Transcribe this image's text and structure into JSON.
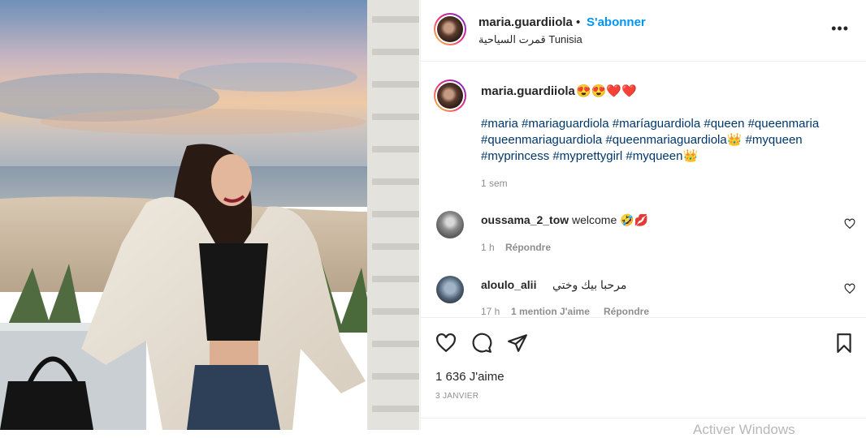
{
  "header": {
    "username": "maria.guardiiola",
    "separator": "•",
    "follow_label": "S'abonner",
    "location": "قمرت السياحية Tunisia",
    "more_label": "•••"
  },
  "caption": {
    "username": "maria.guardiiola",
    "emojis": "😍😍❤️❤️",
    "hashtags_line1": [
      "#maria",
      "#mariaguardiola",
      "#maríaguardiola",
      "#queen",
      "#queenmaria"
    ],
    "hashtags_line2": [
      "#queenmariaguardiola",
      "#queenmariaguardiola👑",
      "#myqueen"
    ],
    "hashtags_line3": [
      "#myprincess",
      "#myprettygirl",
      "#myqueen👑"
    ],
    "time": "1 sem"
  },
  "comments": [
    {
      "username": "oussama_2_tow",
      "text": "welcome 🤣💋",
      "time": "1 h",
      "reply_label": "Répondre"
    },
    {
      "username": "aloulo_alii",
      "text": "مرحبا بيك وختي",
      "time": "17 h",
      "likes_label": "1 mention J'aime",
      "reply_label": "Répondre"
    }
  ],
  "actions": {
    "likes": "1 636 J'aime",
    "date": "3 JANVIER"
  },
  "system": {
    "watermark": "Activer Windows"
  },
  "colors": {
    "accent": "#0095f6",
    "hashtag": "#00376b",
    "muted": "#8e8e8e"
  }
}
